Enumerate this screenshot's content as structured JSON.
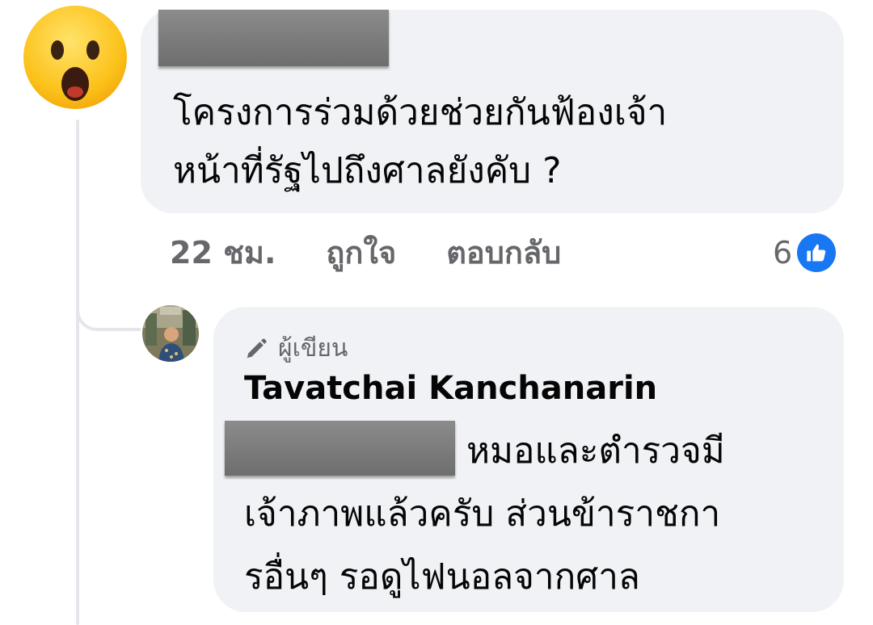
{
  "comment": {
    "text": "โครงการร่วมด้วยช่วยกันฟ้องเจ้า\nหน้าที่รัฐไปถึงศาลยังคับ ?",
    "timestamp": "22 ชม.",
    "like_label": "ถูกใจ",
    "reply_label": "ตอบกลับ",
    "reaction_count": "6",
    "avatar_icon": "surprised-face-emoji-icon",
    "reaction_icon": "thumbs-up-icon",
    "reaction_color": "#1877f2"
  },
  "reply": {
    "badge_label": "ผู้เขียน",
    "badge_icon": "pencil-icon",
    "author_name": "Tavatchai Kanchanarin",
    "text_line1": "หมอและตำรวจมี",
    "text_rest": "เจ้าภาพแล้วครับ ส่วนข้าราชกา\nรอื่นๆ รอดูไฟนอลจากศาล"
  }
}
